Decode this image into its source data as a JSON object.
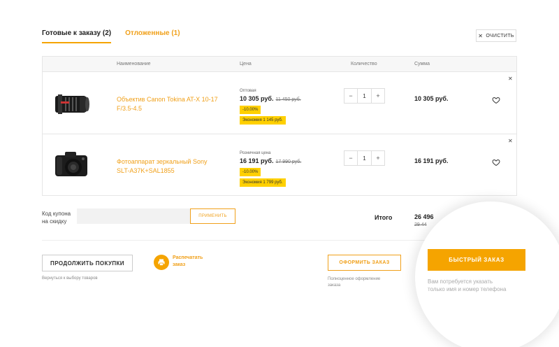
{
  "tabs": [
    {
      "label": "Готовые к заказу",
      "count": "(2)"
    },
    {
      "label": "Отложенные",
      "count": "(1)"
    }
  ],
  "clear_button": {
    "label": "очистить",
    "icon": "close-icon"
  },
  "table": {
    "headers": [
      "Наименование",
      "Цена",
      "Количество",
      "Сумма"
    ],
    "rows": [
      {
        "name": "Объектив Canon Tokina AT-X 10-17 F/3.5-4.5",
        "price_label": "Оптовая",
        "price": "10 305 руб.",
        "old_price": "11 450 руб.",
        "discount": "-10.00%",
        "savings": "Экономия 1 145 руб.",
        "quantity": "1",
        "sum": "10 305 руб.",
        "image_icon": "lens-image"
      },
      {
        "name": "Фотоаппарат зеркальный Sony SLT-A37K+SAL1855",
        "price_label": "Розничная цена",
        "price": "16 191 руб.",
        "old_price": "17 990 руб.",
        "discount": "-10.00%",
        "savings": "Экономия 1 799 руб.",
        "quantity": "1",
        "sum": "16 191 руб.",
        "image_icon": "camera-image"
      }
    ]
  },
  "coupon": {
    "label_line1": "Код купона",
    "label_line2": "на скидку",
    "value": "",
    "apply_label": "применить"
  },
  "total": {
    "label": "Итого",
    "value": "26 496",
    "old_value": "29 44"
  },
  "actions": {
    "continue_label": "ПРОДОЛЖИТЬ ПОКУПКИ",
    "continue_note": "Вернуться к выбору товаров",
    "print_line1": "Распечатать",
    "print_line2": "заказ",
    "checkout_label": "ОФОРМИТЬ ЗАКАЗ",
    "checkout_note_line1": "Полноценное оформление",
    "checkout_note_line2": "заказа",
    "quick_label": "БЫСТРЫЙ ЗАКАЗ",
    "quick_note_line1": "Вам потребуется указать",
    "quick_note_line2": "только имя и номер телефона"
  },
  "colors": {
    "accent": "#f5a400",
    "accent_text": "#f0a01a",
    "badge": "#ffd000"
  }
}
